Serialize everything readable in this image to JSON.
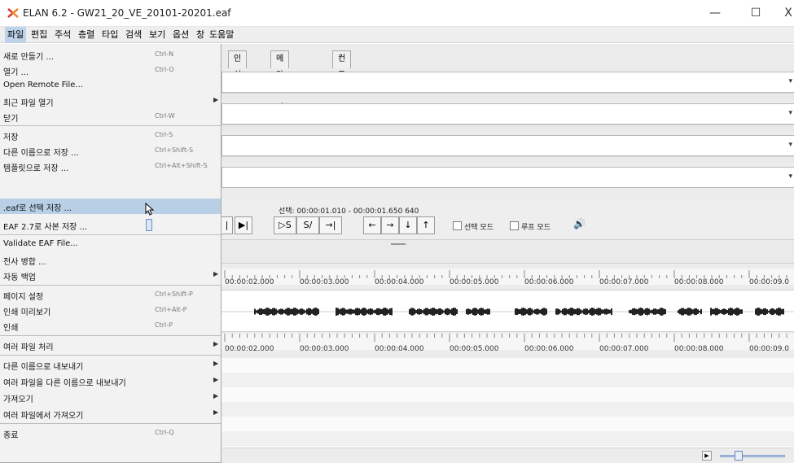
{
  "window": {
    "title": "ELAN 6.2 - GW21_20_VE_20101-20201.eaf",
    "minimize": "—",
    "maximize": "☐",
    "close": "X"
  },
  "menubar": {
    "items": [
      "파일",
      "편집",
      "주석",
      "층렬",
      "타입",
      "검색",
      "보기",
      "옵션",
      "창",
      "도움말"
    ]
  },
  "tabs": [
    "인식기",
    "메타 데이터",
    "컨트롤"
  ],
  "file_menu": {
    "items": [
      {
        "label": "새로 만들기 ...",
        "accel": "Ctrl-N"
      },
      {
        "label": "열기 ...",
        "accel": "Ctrl-O"
      },
      {
        "label": "Open Remote File...",
        "accel": ""
      },
      {
        "label": "최근 파일 열기",
        "accel": "",
        "submenu": true
      },
      {
        "label": "닫기",
        "accel": "Ctrl-W"
      },
      {
        "label": "저장",
        "accel": "Ctrl-S"
      },
      {
        "label": "다른 이름으로 저장 ...",
        "accel": "Ctrl+Shift-S"
      },
      {
        "label": "템플릿으로 저장 ...",
        "accel": "Ctrl+Alt+Shift-S"
      },
      {
        "label": ".eaf로 선택 저장 ...",
        "accel": ""
      },
      {
        "label": "EAF 2.7로 사본 저장 ...",
        "accel": ""
      },
      {
        "label": "Validate EAF File...",
        "accel": ""
      },
      {
        "label": "전사 병합 ...",
        "accel": ""
      },
      {
        "label": "자동 백업",
        "accel": "",
        "submenu": true
      },
      {
        "label": "페이지 설정",
        "accel": "Ctrl+Shift-P"
      },
      {
        "label": "인쇄 미리보기",
        "accel": "Ctrl+Alt-P"
      },
      {
        "label": "인쇄",
        "accel": "Ctrl-P"
      },
      {
        "label": "여러 파일 처리",
        "accel": "",
        "submenu": true
      },
      {
        "label": "다른 이름으로 내보내기",
        "accel": "",
        "submenu": true
      },
      {
        "label": "여러 파일을 다른 이름으로 내보내기",
        "accel": "",
        "submenu": true
      },
      {
        "label": "가져오기",
        "accel": "",
        "submenu": true
      },
      {
        "label": "여러 파일에서 가져오기",
        "accel": "",
        "submenu": true
      },
      {
        "label": "종료",
        "accel": "Ctrl-Q"
      }
    ]
  },
  "player": {
    "selection_text": "선택: 00:00:01.010 - 00:00:01.650  640",
    "btn_play_end": "▶|",
    "btn_ps": "▷S",
    "btn_s_slash": "S/",
    "btn_to_sel": "→|",
    "btn_left": "←",
    "btn_right": "→",
    "btn_down": "↓",
    "btn_up": "↑",
    "selection_mode": "선택 모드",
    "loop_mode": "루프 모드",
    "volume_icon": "🔊"
  },
  "timeline": {
    "ticks": [
      "00:00:02.000",
      "00:00:03.000",
      "00:00:04.000",
      "00:00:05.000",
      "00:00:06.000",
      "00:00:07.000",
      "00:00:08.000",
      "00:00:09.0"
    ]
  },
  "bottom": {
    "play_arrow": "▶"
  }
}
